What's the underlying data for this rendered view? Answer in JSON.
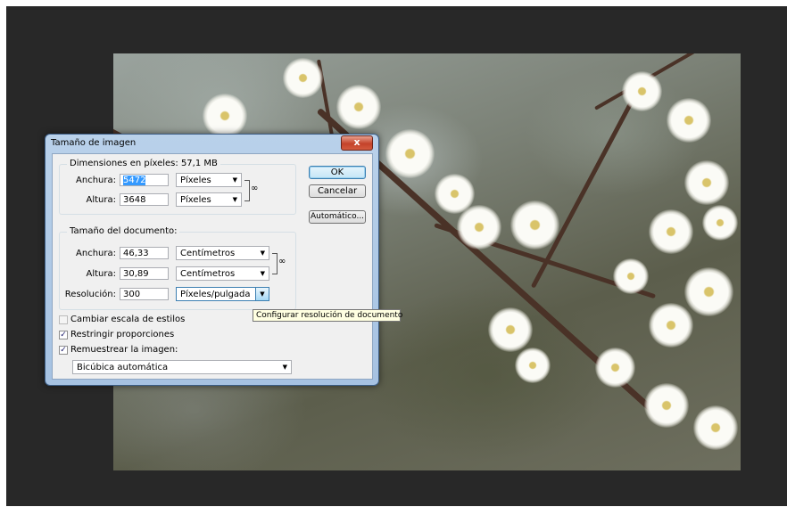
{
  "dialog": {
    "title": "Tamaño de imagen",
    "close_label": "x",
    "pixel_dimensions": {
      "legend": "Dimensiones en píxeles: 57,1 MB",
      "width_label": "Anchura:",
      "width_value": "5472",
      "width_unit": "Píxeles",
      "height_label": "Altura:",
      "height_value": "3648",
      "height_unit": "Píxeles"
    },
    "document_size": {
      "legend": "Tamaño del documento:",
      "width_label": "Anchura:",
      "width_value": "46,33",
      "width_unit": "Centímetros",
      "height_label": "Altura:",
      "height_value": "30,89",
      "height_unit": "Centímetros",
      "resolution_label": "Resolución:",
      "resolution_value": "300",
      "resolution_unit": "Píxeles/pulgada"
    },
    "buttons": {
      "ok": "OK",
      "cancel": "Cancelar",
      "auto": "Automático..."
    },
    "options": {
      "scale_styles": {
        "label": "Cambiar escala de estilos",
        "checked": false
      },
      "constrain": {
        "label": "Restringir proporciones",
        "checked": true
      },
      "resample": {
        "label": "Remuestrear la imagen:",
        "checked": true
      },
      "resample_method": "Bicúbica automática"
    }
  },
  "tooltip": "Configurar resolución de documento",
  "icons": {
    "link": "chain-link-icon",
    "check": "✓",
    "dropdown": "▼"
  }
}
